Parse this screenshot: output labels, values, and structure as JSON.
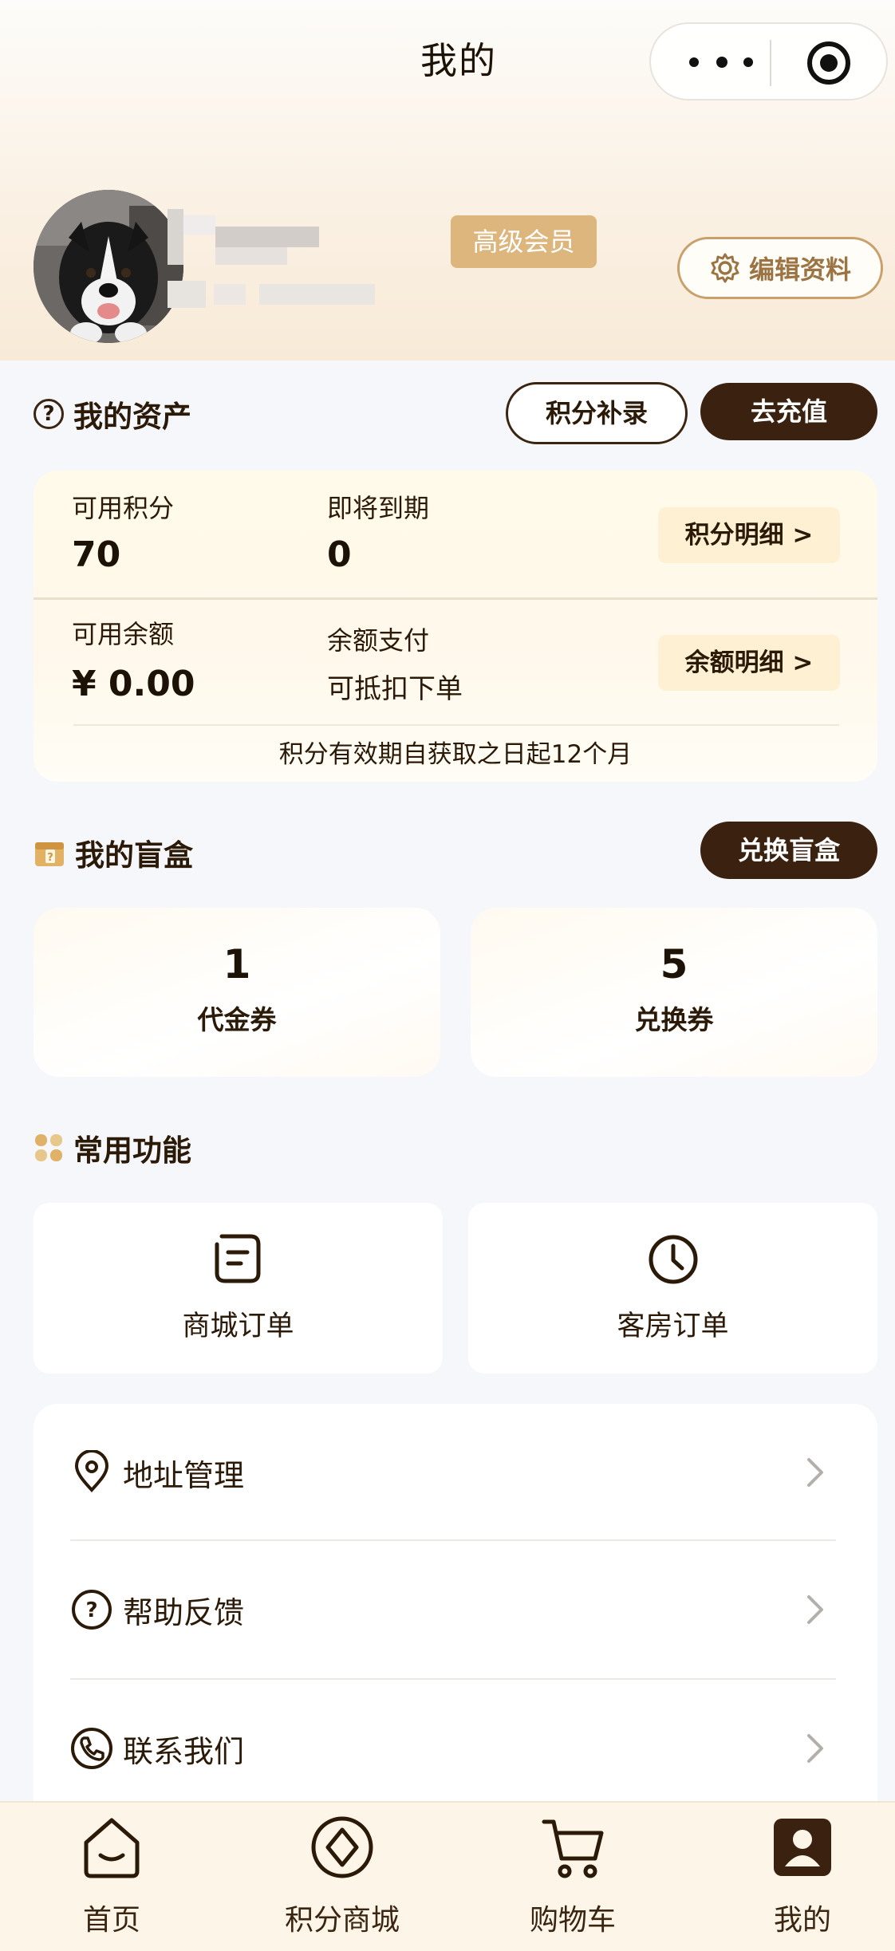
{
  "header": {
    "title": "我的",
    "capsule": {
      "more_icon": "more-dots-icon",
      "close_icon": "target-icon"
    }
  },
  "profile": {
    "avatar": "dog-avatar",
    "member_badge": "高级会员",
    "edit_label": "编辑资料",
    "edit_icon": "gear-icon"
  },
  "assets": {
    "title": "我的资产",
    "help_icon": "question-circle-icon",
    "points_supplement_label": "积分补录",
    "recharge_label": "去充值",
    "available_points_label": "可用积分",
    "available_points_value": "70",
    "expiring_label": "即将到期",
    "expiring_value": "0",
    "points_detail_label": "积分明细 >",
    "balance_label": "可用余额",
    "balance_value": "¥ 0.00",
    "balance_pay_label": "余额支付",
    "balance_pay_text": "可抵扣下单",
    "balance_detail_label": "余额明细 >",
    "validity_note": "积分有效期自获取之日起12个月"
  },
  "blind_box": {
    "title": "我的盲盒",
    "exchange_label": "兑换盲盒",
    "cards": [
      {
        "count": "1",
        "label": "代金券"
      },
      {
        "count": "5",
        "label": "兑换券"
      }
    ]
  },
  "common_functions": {
    "title": "常用功能",
    "items": [
      {
        "label": "商城订单",
        "icon": "order-note-icon"
      },
      {
        "label": "客房订单",
        "icon": "clock-icon"
      }
    ]
  },
  "menu": {
    "items": [
      {
        "label": "地址管理",
        "icon": "location-pin-icon"
      },
      {
        "label": "帮助反馈",
        "icon": "help-circle-icon"
      },
      {
        "label": "联系我们",
        "icon": "phone-icon"
      }
    ]
  },
  "tabbar": {
    "items": [
      {
        "label": "首页",
        "icon": "home-smile-icon"
      },
      {
        "label": "积分商城",
        "icon": "diamond-icon"
      },
      {
        "label": "购物车",
        "icon": "cart-icon"
      },
      {
        "label": "我的",
        "icon": "profile-icon",
        "active": true
      }
    ]
  }
}
